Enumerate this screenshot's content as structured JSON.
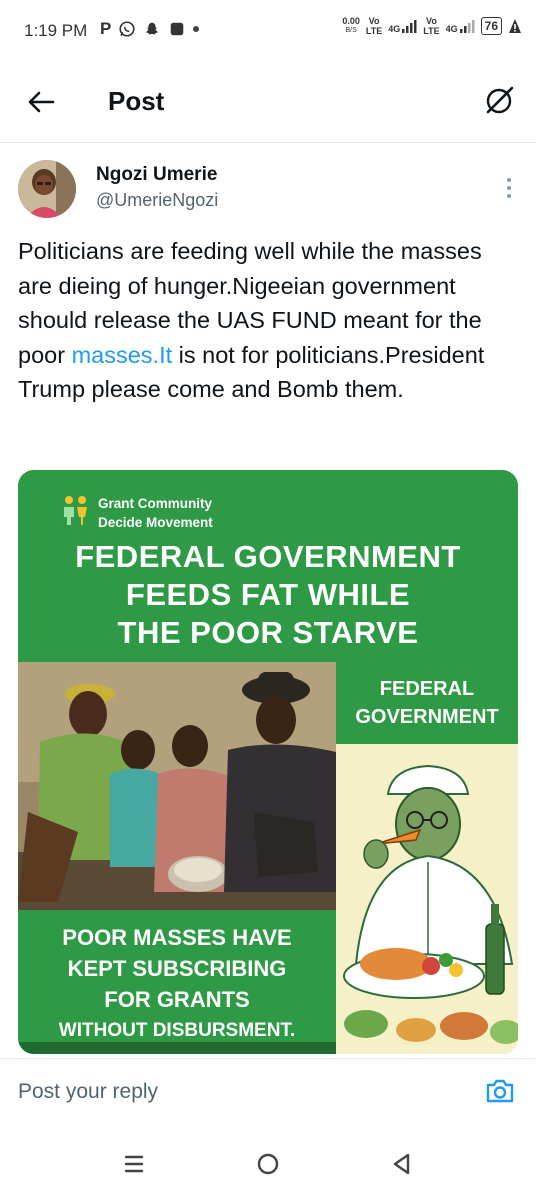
{
  "status_bar": {
    "time": "1:19 PM",
    "app_letter": "P",
    "net_speed_value": "0.00",
    "net_speed_unit": "B/S",
    "vo_lte_1": "Vo\nLTE",
    "net_4g_1": "4G",
    "vo_lte_2": "Vo\nLTE",
    "net_4g_2": "4G",
    "battery": "76",
    "icons": [
      "whatsapp-icon",
      "snapchat-icon",
      "app-square-icon",
      "notification-dot-icon",
      "signal-icon",
      "battery-icon",
      "alert-icon"
    ]
  },
  "header": {
    "title": "Post",
    "back_icon": "arrow-left-icon",
    "right_icon": "grok-icon"
  },
  "author": {
    "name": "Ngozi Umerie",
    "handle": "@UmerieNgozi"
  },
  "tweet": {
    "text_before_link": "Politicians are feeding well while the masses are dieing of hunger.Nigeeian government should release the UAS FUND meant for the poor ",
    "link_text": "masses.It",
    "text_after_link": " is not for politicians.President Trump please come and Bomb them."
  },
  "image_card": {
    "brand_line1": "Grant Community",
    "brand_line2": "Decide Movement",
    "headline_line1": "FEDERAL GOVERNMENT",
    "headline_line2": "FEEDS FAT WHILE",
    "headline_line3": "THE POOR STARVE",
    "fg_line1": "FEDERAL",
    "fg_line2": "GOVERNMENT",
    "bottom_line1": "POOR MASSES HAVE",
    "bottom_line2": "KEPT SUBSCRIBING",
    "bottom_line3": "FOR GRANTS",
    "bottom_line4": "WITHOUT DISBURSMENT."
  },
  "reply": {
    "placeholder": "Post your reply",
    "icon": "camera-icon"
  },
  "nav": {
    "icons": [
      "recent-apps-icon",
      "home-circle-icon",
      "back-triangle-icon"
    ]
  },
  "colors": {
    "link": "#1d9bf0",
    "card_green": "#2f9a46",
    "text_primary": "#0f1419",
    "text_secondary": "#536471"
  }
}
